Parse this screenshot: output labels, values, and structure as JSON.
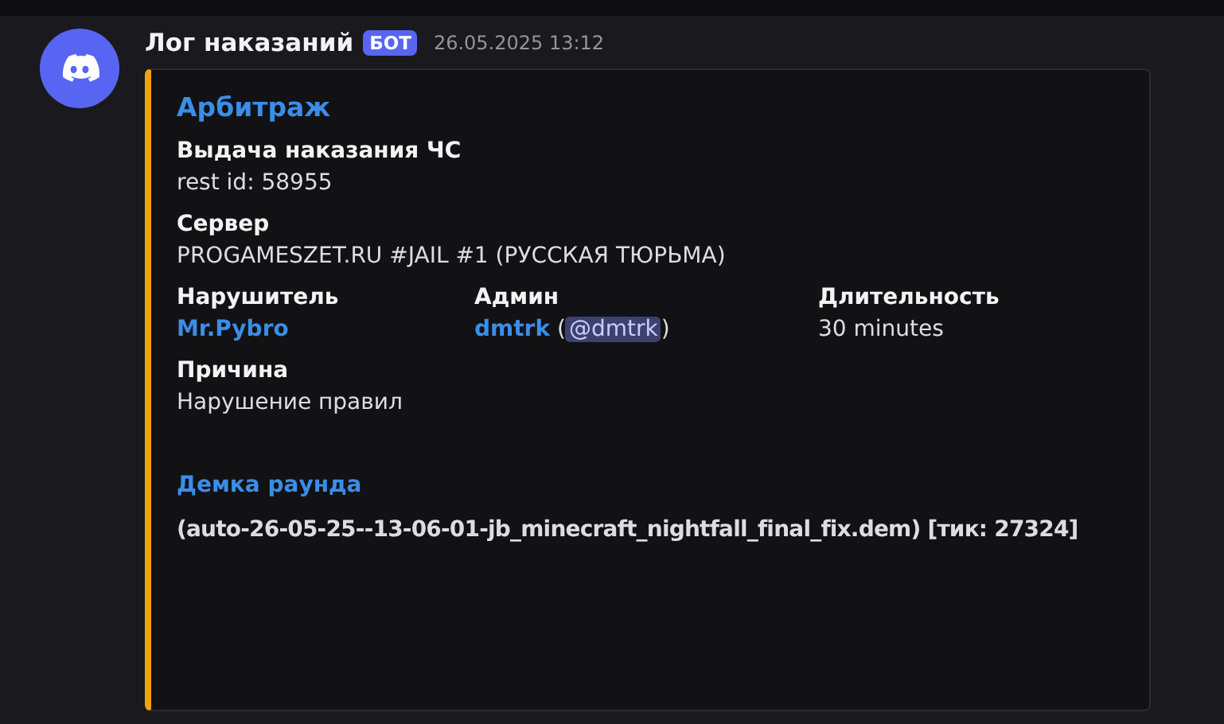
{
  "message": {
    "author": "Лог наказаний",
    "badge": "БОТ",
    "timestamp": "26.05.2025 13:12"
  },
  "embed": {
    "title": "Арбитраж",
    "color": "#f0a20f",
    "fields": [
      {
        "kind": "plain",
        "inline": false,
        "name": "Выдача наказания ЧС",
        "value": [
          {
            "kind": "text",
            "text": "rest id: 58955"
          }
        ]
      },
      {
        "kind": "plain",
        "inline": false,
        "name": "Сервер",
        "value": [
          {
            "kind": "text",
            "text": "PROGAMESZET.RU #JAIL #1 (РУССКАЯ ТЮРЬМА)"
          }
        ]
      },
      {
        "kind": "plain",
        "inline": true,
        "name": "Нарушитель",
        "value": [
          {
            "kind": "link",
            "text": "Mr.Pybro"
          }
        ]
      },
      {
        "kind": "plain",
        "inline": true,
        "name": "Админ",
        "value": [
          {
            "kind": "link",
            "text": "dmtrk"
          },
          {
            "kind": "text",
            "text": " ("
          },
          {
            "kind": "mention",
            "text": "@dmtrk"
          },
          {
            "kind": "text",
            "text": ")"
          }
        ]
      },
      {
        "kind": "plain",
        "inline": true,
        "name": "Длительность",
        "value": [
          {
            "kind": "text",
            "text": "30 minutes"
          }
        ]
      },
      {
        "kind": "plain",
        "inline": false,
        "name": "Причина",
        "value": [
          {
            "kind": "text",
            "text": "Нарушение правил"
          }
        ]
      },
      {
        "kind": "demo",
        "inline": false,
        "name": "Демка раунда",
        "value": [
          {
            "kind": "text",
            "text": "(auto-26-05-25--13-06-01-jb_minecraft_nightfall_final_fix.dem) [тик: 27324]"
          }
        ]
      }
    ]
  }
}
